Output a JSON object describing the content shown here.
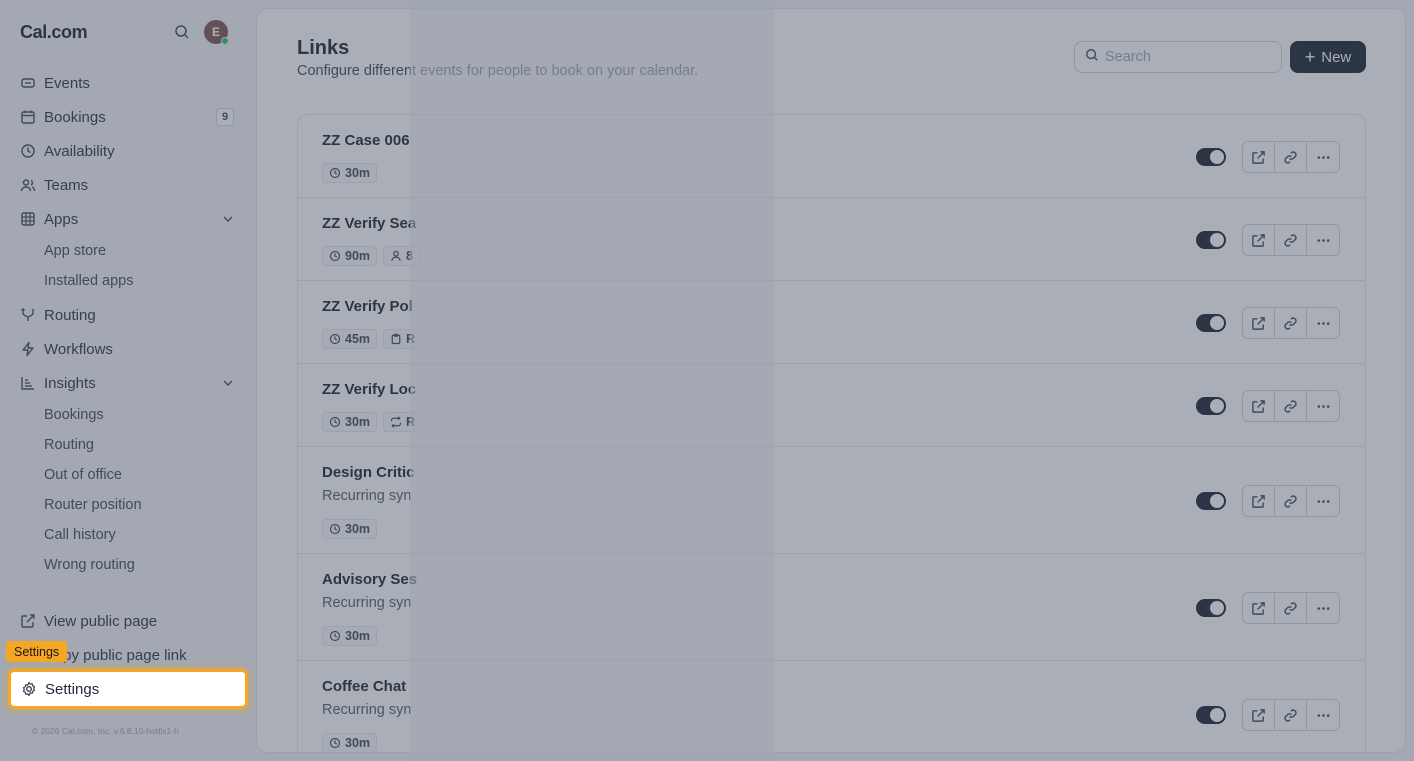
{
  "sidebar": {
    "brand": "Cal.com",
    "avatar_initial": "E",
    "items": [
      {
        "label": "Events",
        "icon": "link-icon"
      },
      {
        "label": "Bookings",
        "icon": "calendar-icon",
        "badge": "9"
      },
      {
        "label": "Availability",
        "icon": "clock-icon"
      },
      {
        "label": "Teams",
        "icon": "users-icon"
      },
      {
        "label": "Apps",
        "icon": "grid-icon"
      },
      {
        "label": "Routing",
        "icon": "split-icon"
      },
      {
        "label": "Workflows",
        "icon": "zap-icon"
      },
      {
        "label": "Insights",
        "icon": "chart-icon"
      }
    ],
    "apps_sub": [
      "App store",
      "Installed apps"
    ],
    "insights_sub": [
      "Bookings",
      "Routing",
      "Out of office",
      "Router position",
      "Call history",
      "Wrong routing"
    ],
    "view_public_page": "View public page",
    "copy_public_link": "Copy public page link",
    "settings": "Settings",
    "tooltip": "Settings",
    "footer": "© 2026 Cal.com, Inc. v.6.8.10-hotfix1-h"
  },
  "main": {
    "title": "Links",
    "subtitle": "Configure different events for people to book on your calendar.",
    "search_placeholder": "Search",
    "new_label": "New",
    "rows": [
      {
        "title": "ZZ Case 006",
        "desc": "",
        "chips": [
          {
            "icon": "clock-icon",
            "text": "30m"
          }
        ]
      },
      {
        "title": "ZZ Verify Sea",
        "desc": "",
        "chips": [
          {
            "icon": "clock-icon",
            "text": "90m"
          },
          {
            "icon": "user-icon",
            "text": "8"
          }
        ]
      },
      {
        "title": "ZZ Verify Pol",
        "desc": "",
        "chips": [
          {
            "icon": "clock-icon",
            "text": "45m"
          },
          {
            "icon": "clipboard-icon",
            "text": "R"
          }
        ]
      },
      {
        "title": "ZZ Verify Loc",
        "desc": "",
        "chips": [
          {
            "icon": "clock-icon",
            "text": "30m"
          },
          {
            "icon": "repeat-icon",
            "text": "R"
          }
        ]
      },
      {
        "title": "Design Critic",
        "desc": "Recurring syn",
        "chips": [
          {
            "icon": "clock-icon",
            "text": "30m"
          }
        ]
      },
      {
        "title": "Advisory Ses",
        "desc": "Recurring syn",
        "chips": [
          {
            "icon": "clock-icon",
            "text": "30m"
          }
        ]
      },
      {
        "title": "Coffee Chat",
        "desc": "Recurring syn",
        "chips": [
          {
            "icon": "clock-icon",
            "text": "30m"
          }
        ]
      }
    ]
  },
  "colors": {
    "accent": "#f5a623",
    "primary": "#111827"
  }
}
